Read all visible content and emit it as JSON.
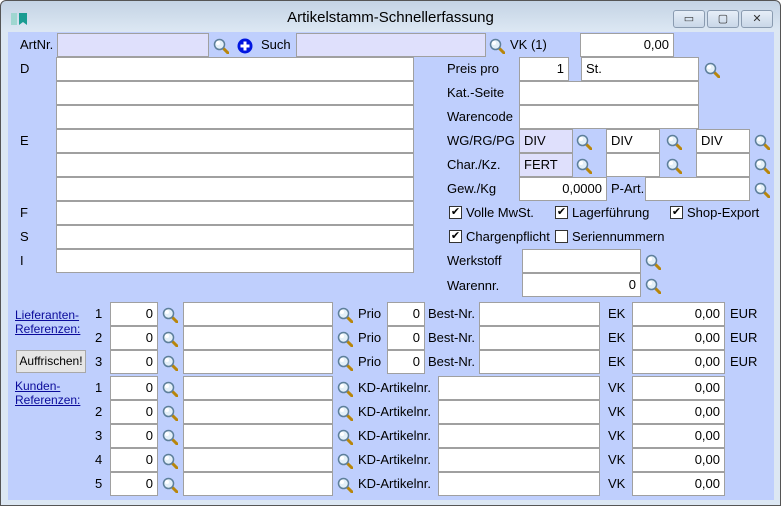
{
  "window": {
    "title": "Artikelstamm-Schnellerfassung",
    "minimize": "▭",
    "maximize": "▢",
    "close": "✕"
  },
  "header": {
    "artnr_label": "ArtNr.",
    "artnr_value": "",
    "such_label": "Such",
    "such_value": "",
    "vk_label": "VK (1)",
    "vk_value": "0,00"
  },
  "text_labels": {
    "d": "D",
    "e": "E",
    "f": "F",
    "s": "S",
    "i": "I"
  },
  "right": {
    "preis_pro_label": "Preis pro",
    "preis_pro_value": "1",
    "unit_value": "St.",
    "kat_seite_label": "Kat.-Seite",
    "kat_seite_value": "",
    "warencode_label": "Warencode",
    "warencode_value": "",
    "wg_label": "WG/RG/PG",
    "wg_value": "DIV",
    "rg_value": "DIV",
    "pg_value": "DIV",
    "char_label": "Char./Kz.",
    "char_value": "FERT",
    "kz1_value": "",
    "kz2_value": "",
    "gew_label": "Gew./Kg",
    "gew_value": "0,0000",
    "part_label": "P-Art.",
    "part_value": "",
    "werkstoff_label": "Werkstoff",
    "werkstoff_value": "",
    "warennr_label": "Warennr.",
    "warennr_value": "0"
  },
  "checkboxes": [
    {
      "label": "Volle MwSt.",
      "checked": true
    },
    {
      "label": "Lagerführung",
      "checked": true
    },
    {
      "label": "Shop-Export",
      "checked": true
    },
    {
      "label": "Chargenpflicht",
      "checked": true
    },
    {
      "label": "Seriennummern",
      "checked": false
    }
  ],
  "lieferanten": {
    "link1": "Lieferanten-",
    "link2": "Referenzen:",
    "refresh_button": "Auffrischen!",
    "prio_label": "Prio",
    "bestnr_label": "Best-Nr.",
    "ek_label": "EK",
    "currency": "EUR",
    "rows": [
      {
        "num": "1",
        "id": "0",
        "name": "",
        "prio": "0",
        "bestnr": "",
        "ek": "0,00"
      },
      {
        "num": "2",
        "id": "0",
        "name": "",
        "prio": "0",
        "bestnr": "",
        "ek": "0,00"
      },
      {
        "num": "3",
        "id": "0",
        "name": "",
        "prio": "0",
        "bestnr": "",
        "ek": "0,00"
      }
    ]
  },
  "kunden": {
    "link1": "Kunden-",
    "link2": "Referenzen:",
    "kdart_label": "KD-Artikelnr.",
    "vk_label": "VK",
    "rows": [
      {
        "num": "1",
        "id": "0",
        "name": "",
        "kdart": "",
        "vk": "0,00"
      },
      {
        "num": "2",
        "id": "0",
        "name": "",
        "kdart": "",
        "vk": "0,00"
      },
      {
        "num": "3",
        "id": "0",
        "name": "",
        "kdart": "",
        "vk": "0,00"
      },
      {
        "num": "4",
        "id": "0",
        "name": "",
        "kdart": "",
        "vk": "0,00"
      },
      {
        "num": "5",
        "id": "0",
        "name": "",
        "kdart": "",
        "vk": "0,00"
      }
    ]
  }
}
